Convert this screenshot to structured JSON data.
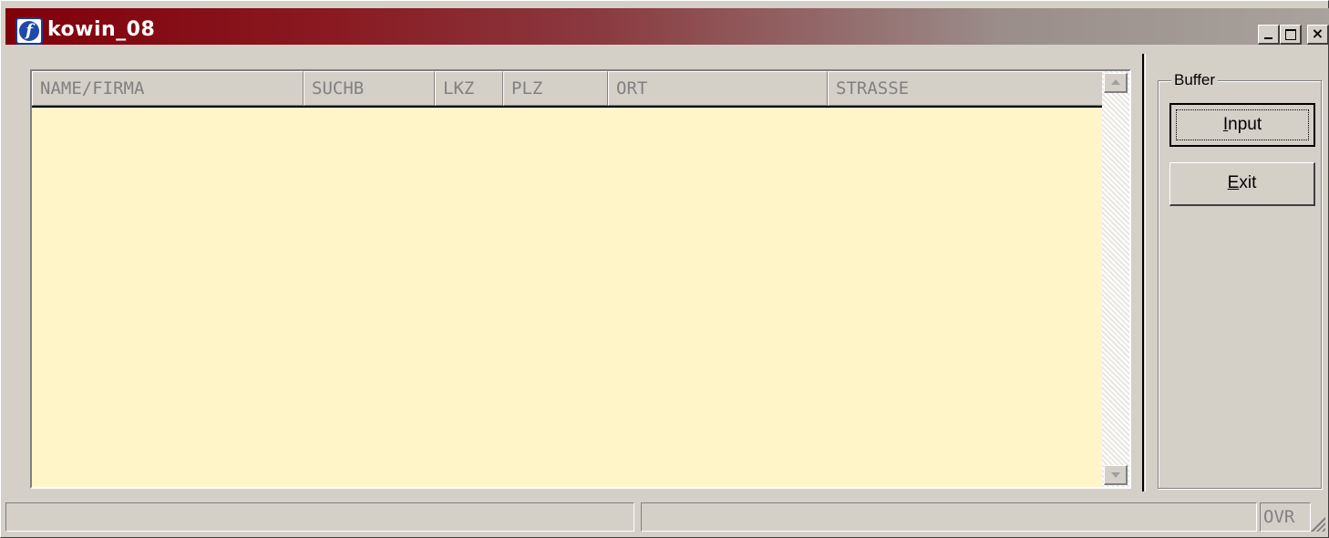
{
  "window": {
    "title": "kowin_08",
    "icon": "app-f-icon"
  },
  "titlebar_buttons": {
    "minimize": "minimize-icon",
    "maximize": "maximize-icon",
    "close": "×"
  },
  "list": {
    "columns": [
      "NAME/FIRMA",
      "SUCHB",
      "LKZ",
      "PLZ",
      "ORT",
      "STRASSE"
    ],
    "rows": [],
    "background": "#fff5c8"
  },
  "buffer_group": {
    "label": "Buffer",
    "input_button": {
      "mnemonic": "I",
      "rest": "nput"
    },
    "exit_button": {
      "mnemonic": "E",
      "rest": "xit"
    }
  },
  "statusbar": {
    "pane1": "",
    "pane2": "",
    "pane3": "OVR"
  },
  "colors": {
    "titlebar_start": "#80000a",
    "titlebar_end": "#a8a39c",
    "face": "#d4d0c8"
  }
}
